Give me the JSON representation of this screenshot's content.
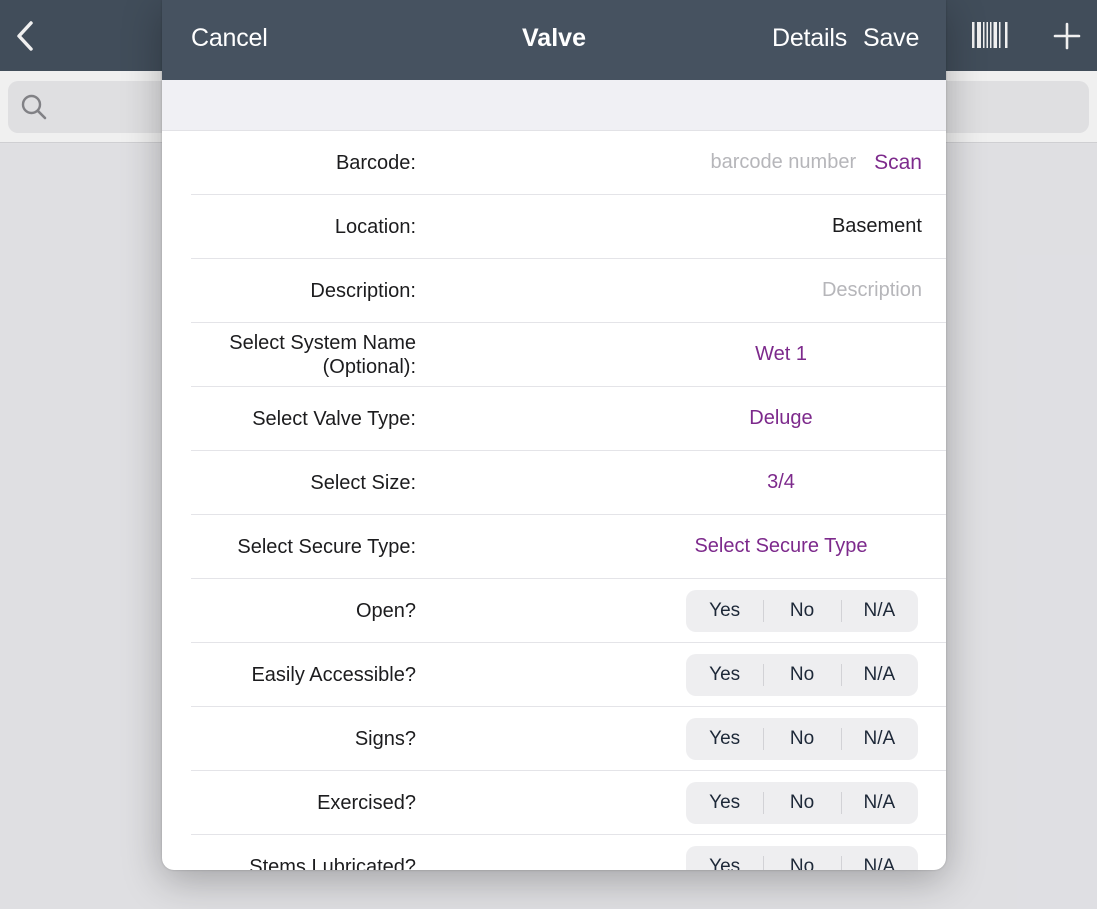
{
  "background": {
    "icons": {
      "back": "chevron-left-icon",
      "barcode": "barcode-icon",
      "add": "plus-icon",
      "search": "search-icon"
    }
  },
  "modal": {
    "nav": {
      "cancel_label": "Cancel",
      "title": "Valve",
      "details_label": "Details",
      "save_label": "Save"
    },
    "fields": {
      "barcode": {
        "label": "Barcode:",
        "placeholder": "barcode number",
        "scan_label": "Scan"
      },
      "location": {
        "label": "Location:",
        "value": "Basement"
      },
      "description": {
        "label": "Description:",
        "placeholder": "Description"
      },
      "system_name": {
        "label_line1": "Select System Name",
        "label_line2": "(Optional):",
        "value": "Wet 1"
      },
      "valve_type": {
        "label": "Select Valve Type:",
        "value": "Deluge"
      },
      "size": {
        "label": "Select Size:",
        "value": "3/4"
      },
      "secure_type": {
        "label": "Select Secure Type:",
        "value": "Select Secure Type"
      }
    },
    "segment_options": [
      "Yes",
      "No",
      "N/A"
    ],
    "questions": [
      {
        "label": "Open?"
      },
      {
        "label": "Easily Accessible?"
      },
      {
        "label": "Signs?"
      },
      {
        "label": "Exercised?"
      },
      {
        "label": "Stems Lubricated?"
      }
    ]
  },
  "colors": {
    "nav_background": "#465260",
    "accent_purple": "#7d2a8c",
    "placeholder_gray": "#b6b6ba",
    "segment_background": "#eeeef0"
  }
}
